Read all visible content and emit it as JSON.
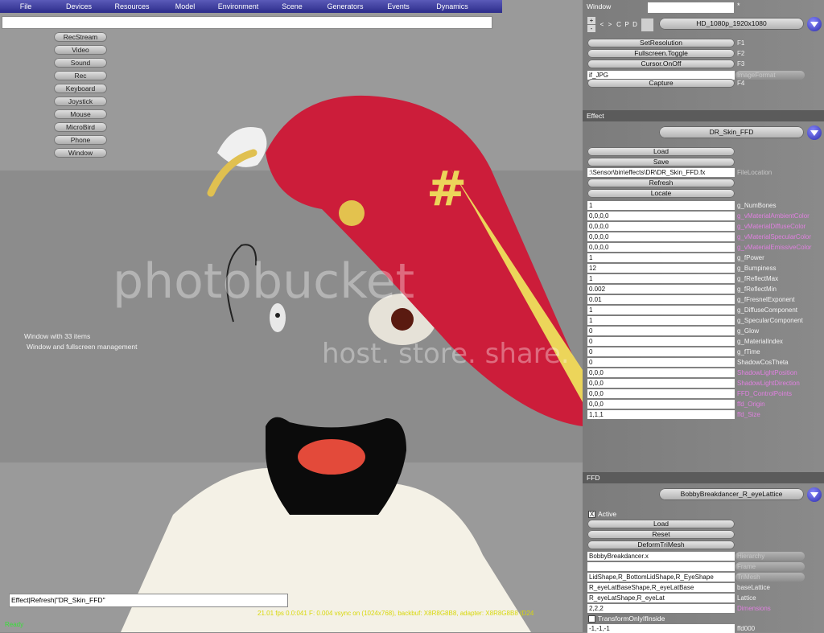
{
  "menu": [
    "File",
    "Devices",
    "Resources",
    "Model",
    "Environment",
    "Scene",
    "Generators",
    "Events",
    "Dynamics"
  ],
  "device_buttons": [
    "RecStream",
    "Video",
    "Sound",
    "Rec",
    "Keyboard",
    "Joystick",
    "Mouse",
    "MicroBird",
    "Phone",
    "Window"
  ],
  "viewport": {
    "info_line1": "Window with 33 items",
    "info_line2": "Window and fullscreen management",
    "command": "Effect|Refresh|\"DR_Skin_FFD\"",
    "status": "Ready",
    "fps_line": "21.01 fps  0.0:041  F: 0.004 vsync on (1024x768), backbuf: X8R8G8B8, adapter: X8R8G8B8 (D24",
    "watermark_line1": "photobucket",
    "watermark_line2": "host. store. share."
  },
  "window_section": {
    "title": "Window",
    "title_field": "",
    "star": "*",
    "mini_buttons": [
      "+",
      "-",
      "<",
      ">",
      "C",
      "P",
      "D"
    ],
    "resolution": "HD_1080p_1920x1080",
    "rows": [
      {
        "button": "SetResolution",
        "key": "F1"
      },
      {
        "button": "Fullscreen.Toggle",
        "key": "F2"
      },
      {
        "button": "Cursor.OnOff",
        "key": "F3"
      }
    ],
    "image_format_value": "if_JPG",
    "image_format_label": "ImageFormat",
    "capture_button": "Capture",
    "capture_key": "F4"
  },
  "effect_section": {
    "title": "Effect",
    "effect_name": "DR_Skin_FFD",
    "load": "Load",
    "save": "Save",
    "file_location_value": ":\\Sensor\\bin\\effects\\DR\\DR_Skin_FFD.fx",
    "file_location_label": "FileLocation",
    "refresh": "Refresh",
    "locate": "Locate",
    "params": [
      {
        "value": "1",
        "label": "g_NumBones",
        "style": "lg"
      },
      {
        "value": "0,0,0,0",
        "label": "g_vMaterialAmbientColor",
        "style": "lp"
      },
      {
        "value": "0,0,0,0",
        "label": "g_vMaterialDiffuseColor",
        "style": "lp"
      },
      {
        "value": "0,0,0,0",
        "label": "g_vMaterialSpecularColor",
        "style": "lp"
      },
      {
        "value": "0,0,0,0",
        "label": "g_vMaterialEmissiveColor",
        "style": "lp"
      },
      {
        "value": "1",
        "label": "g_fPower",
        "style": "lg"
      },
      {
        "value": "12",
        "label": "g_Bumpiness",
        "style": "lg"
      },
      {
        "value": "1",
        "label": "g_fReflectMax",
        "style": "lg"
      },
      {
        "value": "0.002",
        "label": "g_fReflectMin",
        "style": "lg"
      },
      {
        "value": "0.01",
        "label": "g_fFresnelExponent",
        "style": "lg"
      },
      {
        "value": "1",
        "label": "g_DiffuseComponent",
        "style": "lg"
      },
      {
        "value": "1",
        "label": "g_SpecularComponent",
        "style": "lg"
      },
      {
        "value": "0",
        "label": "g_Glow",
        "style": "lg"
      },
      {
        "value": "0",
        "label": "g_MaterialIndex",
        "style": "lg"
      },
      {
        "value": "0",
        "label": "g_fTime",
        "style": "lg"
      },
      {
        "value": "0",
        "label": "ShadowCosTheta",
        "style": "lg"
      },
      {
        "value": "0,0,0",
        "label": "ShadowLightPosition",
        "style": "lp"
      },
      {
        "value": "0,0,0",
        "label": "ShadowLightDirection",
        "style": "lp"
      },
      {
        "value": "0,0,0",
        "label": "FFD_ControlPoints",
        "style": "lp"
      },
      {
        "value": "0,0,0",
        "label": "ffd_Origin",
        "style": "lp"
      },
      {
        "value": "1,1,1",
        "label": "ffd_Size",
        "style": "lp"
      }
    ]
  },
  "ffd_section": {
    "title": "FFD",
    "lattice_name": "BobbyBreakdancer_R_eyeLattice",
    "active_label": "Active",
    "active_mark": "X",
    "load": "Load",
    "reset": "Reset",
    "deform": "DeformTriMesh",
    "fields": [
      {
        "value": "BobbyBreakdancer.x",
        "label": "Hierarchy",
        "style": "ld"
      },
      {
        "value": "",
        "label": "Frame",
        "style": "ld"
      },
      {
        "value": "LidShape,R_BottomLidShape,R_EyeShape",
        "label": "TriMesh",
        "style": "ld"
      },
      {
        "value": "R_eyeLatBaseShape,R_eyeLatBase",
        "label": "baseLattice",
        "style": "lg"
      },
      {
        "value": "R_eyeLatShape,R_eyeLat",
        "label": "Lattice",
        "style": "lg"
      },
      {
        "value": "2,2,2",
        "label": "Dimensions",
        "style": "lp"
      }
    ],
    "transform_label": "TransformOnlyIfInside",
    "last_value": "-1,-1,-1",
    "last_label": "ffd000"
  }
}
